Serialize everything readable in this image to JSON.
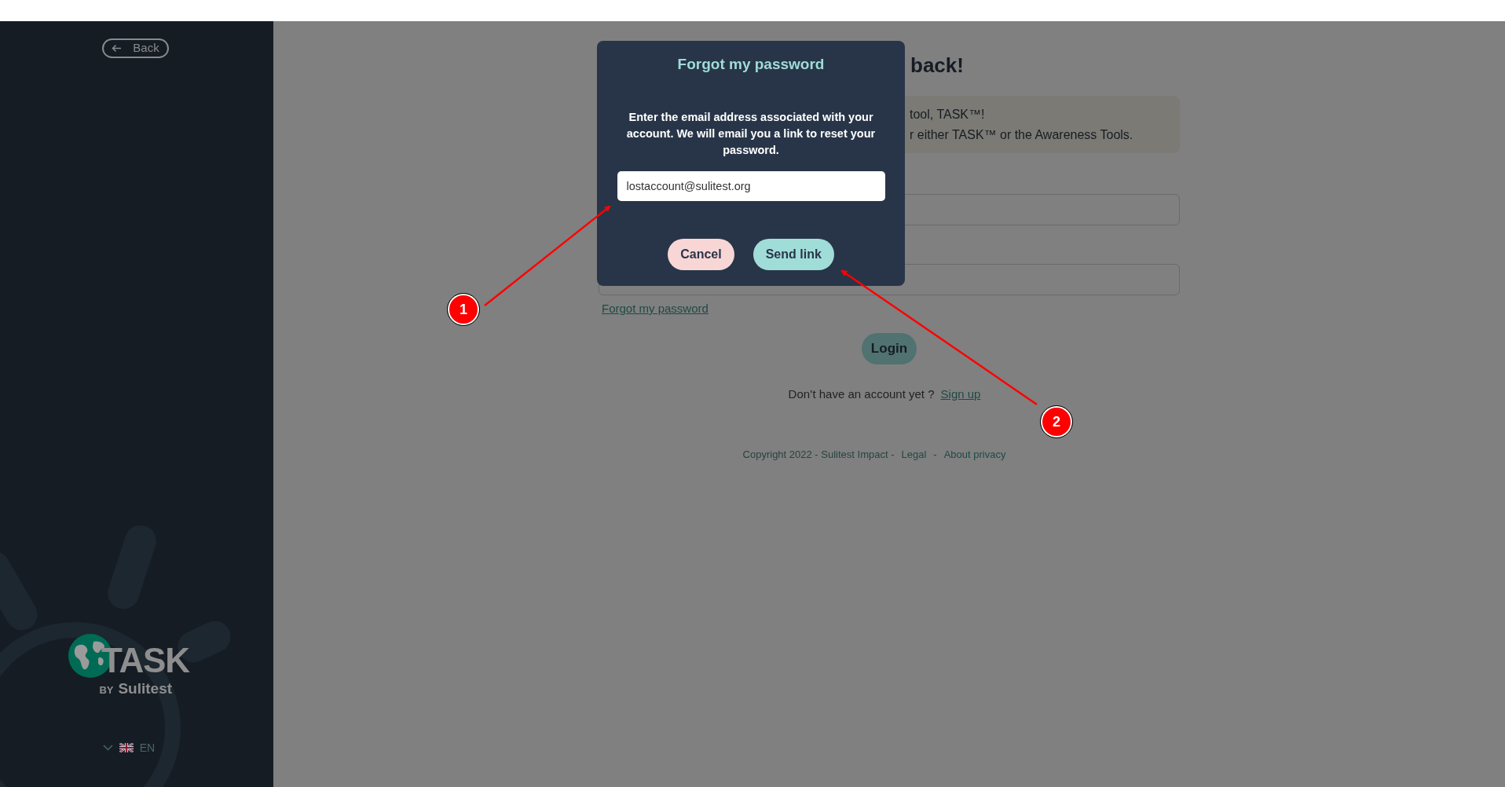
{
  "sidebar": {
    "back_button": "Back",
    "logo": {
      "wordmark": "TASK",
      "byline_prefix": "BY",
      "byline": "Sulitest"
    },
    "language": "EN"
  },
  "page": {
    "heading": "back!",
    "notice_lines": [
      "tool, TASK™!",
      "r either TASK™ or the Awareness Tools."
    ],
    "forgot_link": "Forgot my password",
    "login_button": "Login",
    "signup_prompt": "Don’t have an account yet ?",
    "signup_link": "Sign up",
    "footer": [
      {
        "text": "Copyright 2022 - Sulitest Impact -",
        "kind": "text"
      },
      {
        "text": "Legal",
        "kind": "link"
      },
      {
        "text": "-",
        "kind": "text"
      },
      {
        "text": "About privacy",
        "kind": "link"
      }
    ]
  },
  "dialog": {
    "title": "Forgot my password",
    "message": "Enter the email address associated with your account. We will email you a link to reset your password.",
    "email_value": "lostaccount@sulitest.org",
    "buttons": [
      {
        "label": "Cancel",
        "kind": "cancel"
      },
      {
        "label": "Send link",
        "kind": "primary"
      }
    ]
  },
  "annotations": [
    {
      "label": "1"
    },
    {
      "label": "2"
    }
  ]
}
